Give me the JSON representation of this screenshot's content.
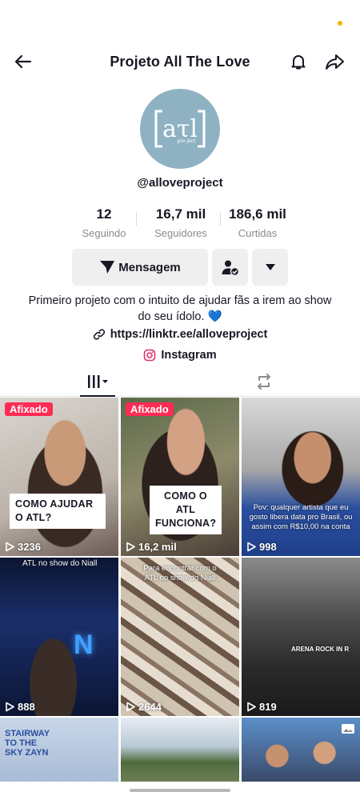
{
  "header": {
    "title": "Projeto All The Love"
  },
  "profile": {
    "username": "@alloveproject",
    "bio": "Primeiro projeto com o intuito de ajudar fãs a irem ao show do seu ídolo. 💙",
    "link": "https://linktr.ee/alloveproject",
    "instagram": "Instagram",
    "avatar_text_main": "aτl",
    "avatar_text_small": "pro ject"
  },
  "stats": [
    {
      "value": "12",
      "label": "Seguindo"
    },
    {
      "value": "16,7 mil",
      "label": "Seguidores"
    },
    {
      "value": "186,6 mil",
      "label": "Curtidas"
    }
  ],
  "actions": {
    "message_label": "Mensagem"
  },
  "videos": [
    {
      "pinned": "Afixado",
      "views": "3236",
      "caption": "COMO AJUDAR O ATL?"
    },
    {
      "pinned": "Afixado",
      "views": "16,2 mil",
      "caption": "COMO O ATL FUNCIONA?"
    },
    {
      "views": "998",
      "overlay": "Pov: qualquer artista que eu gosto libera data pro Brasil, ou assim com R$10,00 na conta"
    },
    {
      "views": "888",
      "overlay": "ATL no show do Niall",
      "sign": "N"
    },
    {
      "views": "2644",
      "overlay": "Para encontrar com o ATL no show do Niall"
    },
    {
      "views": "819",
      "overlay": "ARENA ROCK IN R"
    },
    {
      "overlay": "STAIRWAY TO THE SKY ZAYN"
    },
    {},
    {}
  ],
  "colors": {
    "accent": "#fe2c55",
    "text": "#161823",
    "muted": "#8a8b91",
    "avatar_bg": "#8fb2c3",
    "heart": "#3b8fe0"
  }
}
